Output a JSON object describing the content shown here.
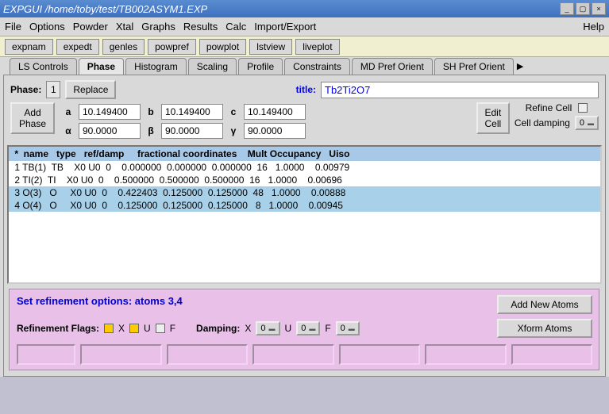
{
  "window": {
    "title": "EXPGUI /home/toby/test/TB002ASYM1.EXP"
  },
  "menu": {
    "file": "File",
    "options": "Options",
    "powder": "Powder",
    "xtal": "Xtal",
    "graphs": "Graphs",
    "results": "Results",
    "calc": "Calc",
    "impexp": "Import/Export",
    "help": "Help"
  },
  "toolbar": {
    "expnam": "expnam",
    "expedt": "expedt",
    "genles": "genles",
    "powpref": "powpref",
    "powplot": "powplot",
    "lstview": "lstview",
    "liveplot": "liveplot"
  },
  "tabs": {
    "ls": "LS Controls",
    "phase": "Phase",
    "hist": "Histogram",
    "scaling": "Scaling",
    "profile": "Profile",
    "constraints": "Constraints",
    "mdpref": "MD Pref Orient",
    "shpref": "SH Pref Orient"
  },
  "phase": {
    "label": "Phase:",
    "num": "1",
    "replace": "Replace",
    "titleLabel": "title:",
    "title": "Tb2Ti2O7",
    "addPhase": "Add Phase",
    "a_l": "a",
    "a": "10.149400",
    "b_l": "b",
    "b": "10.149400",
    "c_l": "c",
    "c": "10.149400",
    "al_l": "α",
    "al": "90.0000",
    "be_l": "β",
    "be": "90.0000",
    "ga_l": "γ",
    "ga": "90.0000",
    "editCell": "Edit Cell",
    "refineCell": "Refine Cell",
    "cellDamp": "Cell damping",
    "cellDampVal": "0"
  },
  "atoms": {
    "header": " *  name   type   ref/damp     fractional coordinates    Mult Occupancy   Uiso",
    "rows": [
      " 1 TB(1)  TB    X0 U0  0    0.000000  0.000000  0.000000  16   1.0000    0.00979",
      " 2 TI(2)  TI    X0 U0  0    0.500000  0.500000  0.500000  16   1.0000    0.00696",
      " 3 O(3)   O     X0 U0  0    0.422403  0.125000  0.125000  48   1.0000    0.00888",
      " 4 O(4)   O     X0 U0  0    0.125000  0.125000  0.125000   8   1.0000    0.00945"
    ],
    "selected": [
      2,
      3
    ]
  },
  "refine": {
    "title": "Set refinement options: atoms 3,4",
    "flagsLabel": "Refinement Flags:",
    "X": "X",
    "U": "U",
    "F": "F",
    "dampLabel": "Damping:",
    "dx": "0",
    "du": "0",
    "df": "0",
    "addNew": "Add New Atoms",
    "xform": "Xform Atoms"
  }
}
